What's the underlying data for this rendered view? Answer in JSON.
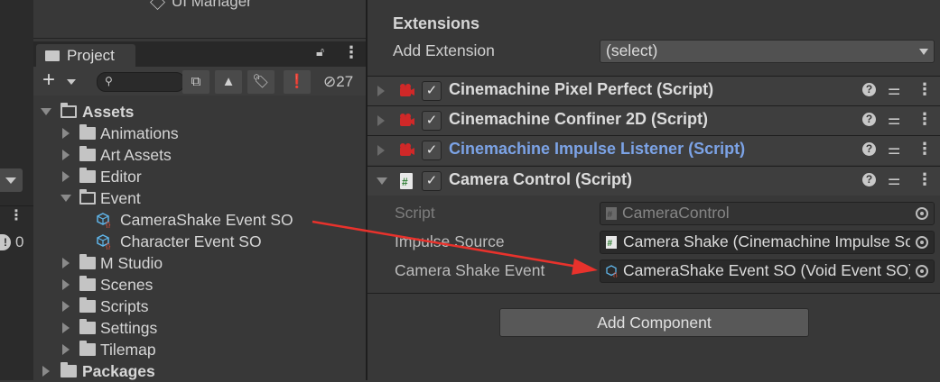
{
  "hierarchy": {
    "partial_item": "UI Manager"
  },
  "left_strip": {
    "warning_count": "0"
  },
  "project": {
    "tab_label": "Project",
    "hidden_count": "27",
    "search_placeholder": "",
    "tree": [
      {
        "label": "Assets",
        "level": 0,
        "expanded": true,
        "type": "folder",
        "bold": true
      },
      {
        "label": "Animations",
        "level": 1,
        "type": "folder"
      },
      {
        "label": "Art Assets",
        "level": 1,
        "type": "folder"
      },
      {
        "label": "Editor",
        "level": 1,
        "type": "folder"
      },
      {
        "label": "Event",
        "level": 1,
        "expanded": true,
        "type": "folder"
      },
      {
        "label": "CameraShake Event SO",
        "level": 2,
        "type": "scriptable-object"
      },
      {
        "label": "Character Event SO",
        "level": 2,
        "type": "scriptable-object"
      },
      {
        "label": "M Studio",
        "level": 1,
        "type": "folder"
      },
      {
        "label": "Scenes",
        "level": 1,
        "type": "folder"
      },
      {
        "label": "Scripts",
        "level": 1,
        "type": "folder"
      },
      {
        "label": "Settings",
        "level": 1,
        "type": "folder"
      },
      {
        "label": "Tilemap",
        "level": 1,
        "type": "folder"
      },
      {
        "label": "Packages",
        "level": 0,
        "type": "folder",
        "bold": true
      }
    ]
  },
  "inspector": {
    "extensions_title": "Extensions",
    "add_extension_label": "Add Extension",
    "add_extension_value": "(select)",
    "components": [
      {
        "title": "Cinemachine Pixel Perfect (Script)",
        "enabled": true,
        "expanded": false,
        "highlight": false
      },
      {
        "title": "Cinemachine Confiner 2D (Script)",
        "enabled": true,
        "expanded": false,
        "highlight": false
      },
      {
        "title": "Cinemachine Impulse Listener (Script)",
        "enabled": true,
        "expanded": false,
        "highlight": true
      },
      {
        "title": "Camera Control (Script)",
        "enabled": true,
        "expanded": true,
        "highlight": false
      }
    ],
    "camera_control": {
      "script_label": "Script",
      "script_value": "CameraControl",
      "impulse_label": "Impulse Source",
      "impulse_value": "Camera Shake (Cinemachine Impulse Source)",
      "event_label": "Camera Shake Event",
      "event_value": "CameraShake Event SO (Void Event SO)"
    },
    "add_component_label": "Add Component"
  },
  "colors": {
    "accent_link": "#7ca3e6",
    "annotation_arrow": "#e8322c",
    "panel_bg": "#383838"
  }
}
